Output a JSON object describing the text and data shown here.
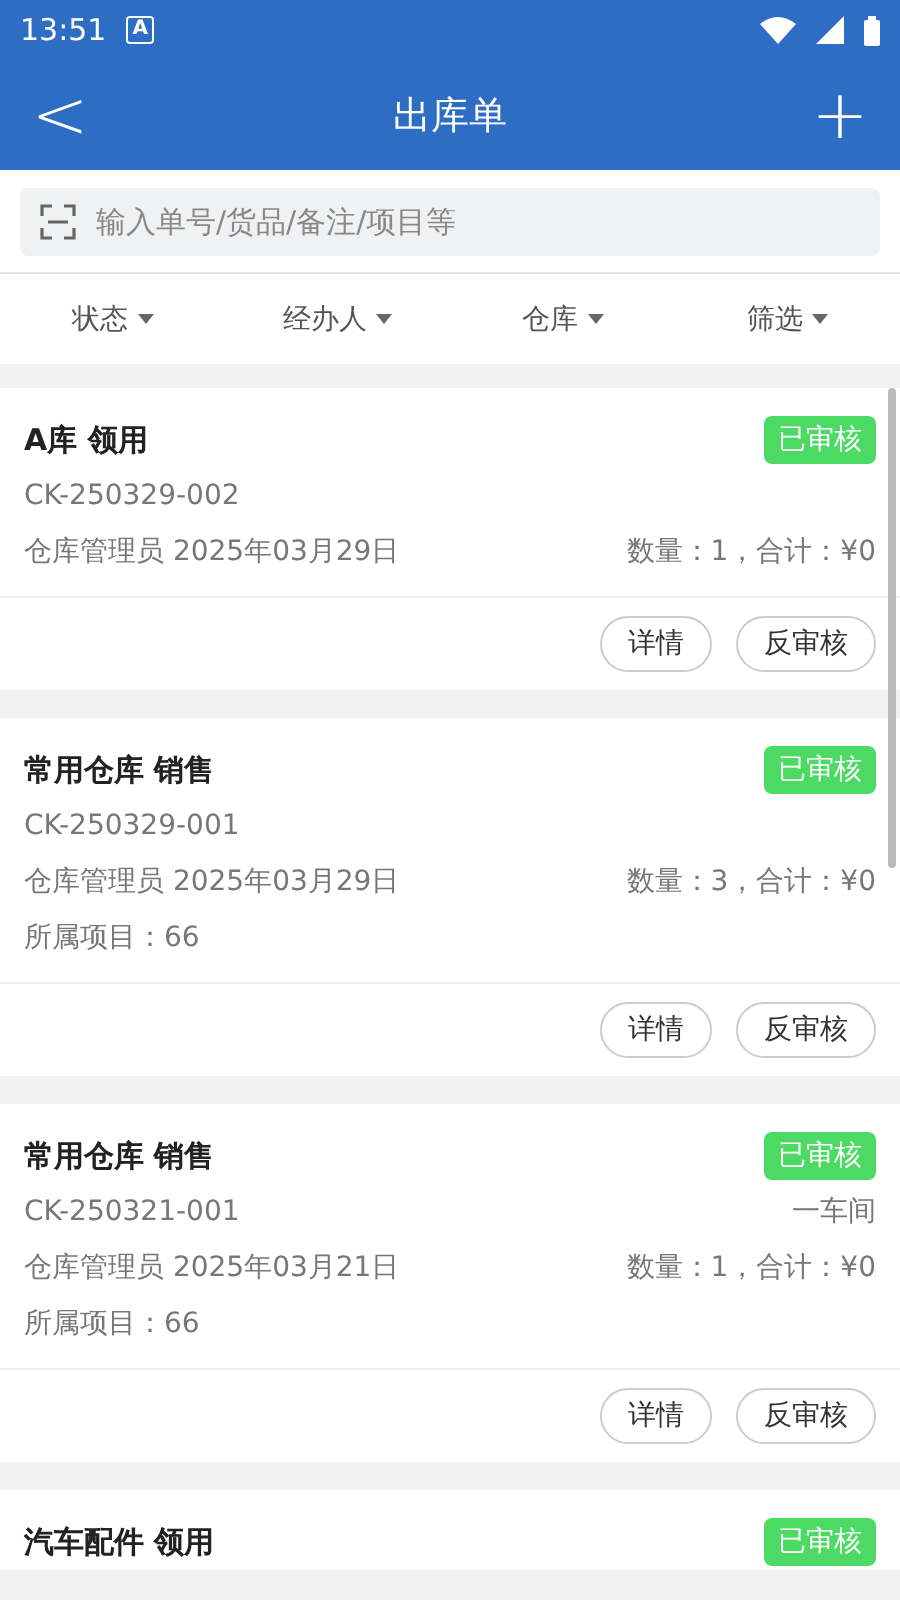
{
  "status_bar": {
    "time": "13:51",
    "notification": "A"
  },
  "header": {
    "back": "<",
    "title": "出库单",
    "add": "+"
  },
  "search": {
    "placeholder": "输入单号/货品/备注/项目等"
  },
  "filters": [
    {
      "label": "状态"
    },
    {
      "label": "经办人"
    },
    {
      "label": "仓库"
    },
    {
      "label": "筛选"
    }
  ],
  "orders": [
    {
      "title": "A库 领用",
      "status": "已审核",
      "code": "CK-250329-002",
      "handler": "仓库管理员 2025年03月29日",
      "summary": "数量：1，合计：¥0",
      "buttons": [
        "详情",
        "反审核"
      ]
    },
    {
      "title": "常用仓库 销售",
      "status": "已审核",
      "code": "CK-250329-001",
      "handler": "仓库管理员 2025年03月29日",
      "summary": "数量：3，合计：¥0",
      "project": "所属项目：66",
      "buttons": [
        "详情",
        "反审核"
      ]
    },
    {
      "title": "常用仓库 销售",
      "status": "已审核",
      "code": "CK-250321-001",
      "department": "一车间",
      "handler": "仓库管理员 2025年03月21日",
      "summary": "数量：1，合计：¥0",
      "project": "所属项目：66",
      "buttons": [
        "详情",
        "反审核"
      ]
    },
    {
      "title": "汽车配件 领用",
      "status": "已审核"
    }
  ]
}
